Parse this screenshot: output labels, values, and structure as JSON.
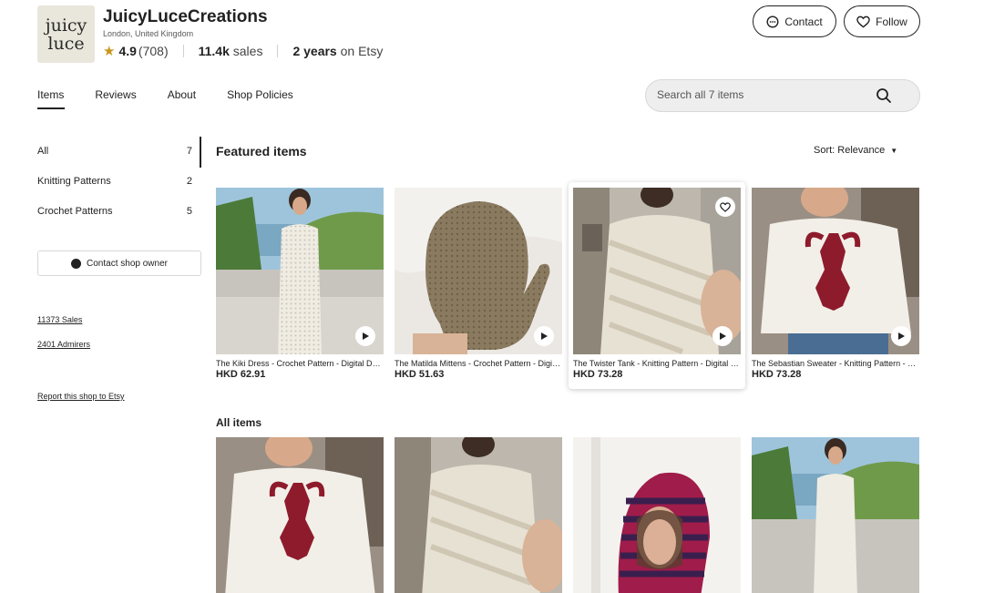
{
  "shop": {
    "logo_line1": "juicy",
    "logo_line2": "luce",
    "name": "JuicyLuceCreations",
    "location": "London, United Kingdom",
    "rating": "4.9",
    "rating_count": "(708)",
    "sales_value": "11.4k",
    "sales_label": " sales",
    "years_value": "2 years",
    "years_label": " on Etsy"
  },
  "actions": {
    "contact_label": "Contact",
    "follow_label": "Follow"
  },
  "tabs": [
    {
      "label": "Items",
      "active": true
    },
    {
      "label": "Reviews"
    },
    {
      "label": "About"
    },
    {
      "label": "Shop Policies"
    }
  ],
  "search": {
    "placeholder": "Search all 7 items"
  },
  "sidebar": {
    "categories": [
      {
        "label": "All",
        "count": "7"
      },
      {
        "label": "Knitting Patterns",
        "count": "2"
      },
      {
        "label": "Crochet Patterns",
        "count": "5"
      }
    ],
    "contact_owner_label": "Contact shop owner",
    "sales_link": "11373 Sales",
    "admirers_link": "2401 Admirers",
    "report_link": "Report this shop to Etsy"
  },
  "featured": {
    "title": "Featured items",
    "sort_label": "Sort: Relevance",
    "items": [
      {
        "title": "The Kiki Dress - Crochet Pattern - Digital Download",
        "price": "HKD 62.91"
      },
      {
        "title": "The Matilda Mittens - Crochet Pattern - Digital Download",
        "price": "HKD 51.63"
      },
      {
        "title": "The Twister Tank - Knitting Pattern - Digital Download",
        "price": "HKD 73.28"
      },
      {
        "title": "The Sebastian Sweater - Knitting Pattern - Digital Download",
        "price": "HKD 73.28"
      }
    ]
  },
  "all_items": {
    "title": "All items"
  },
  "colors": {
    "text": "#222222",
    "star": "#c9951c",
    "lobster": "#8e1b2c",
    "search_bg": "#eeeeee"
  }
}
